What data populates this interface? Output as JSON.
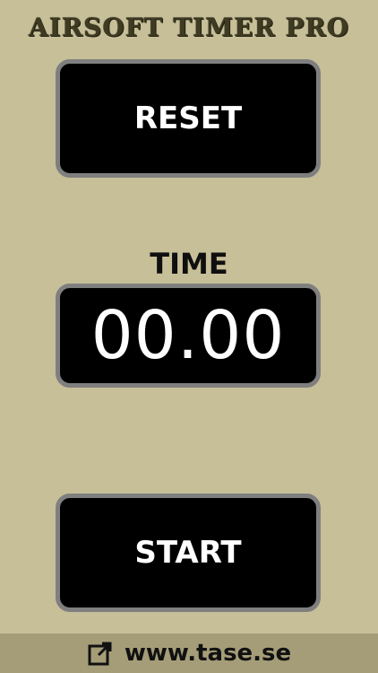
{
  "app": {
    "title": "AIRSOFT TIMER PRO"
  },
  "controls": {
    "reset_label": "RESET",
    "start_label": "START"
  },
  "timer": {
    "label": "TIME",
    "value": "00.00"
  },
  "footer": {
    "link_text": "www.tase.se",
    "icon": "external-link-icon"
  },
  "colors": {
    "background": "#c7bf98",
    "footer_background": "#a59d78",
    "button_bg": "#000000",
    "button_border": "#7f7f7f"
  }
}
